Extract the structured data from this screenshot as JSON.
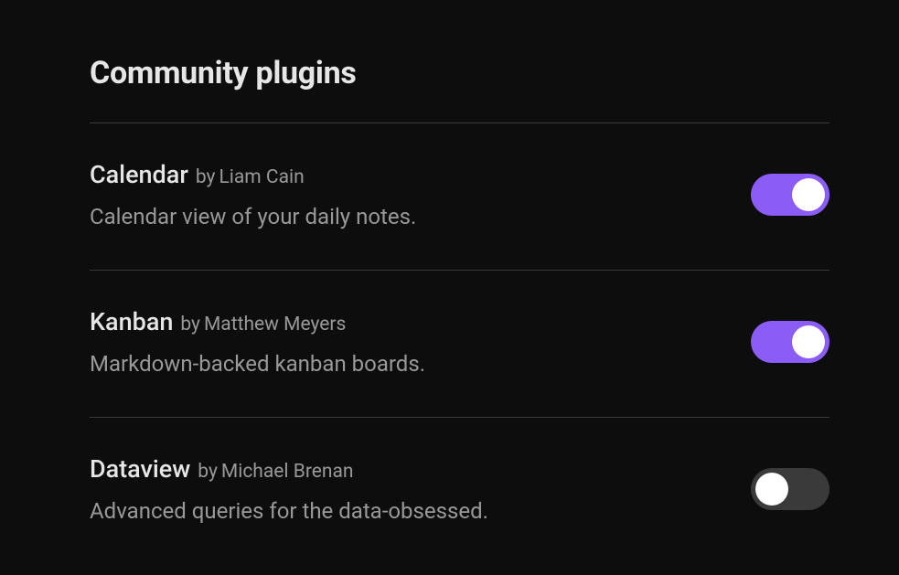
{
  "title": "Community plugins",
  "byLabel": "by",
  "plugins": [
    {
      "name": "Calendar",
      "author": "Liam Cain",
      "description": "Calendar view of your daily notes.",
      "enabled": true
    },
    {
      "name": "Kanban",
      "author": "Matthew Meyers",
      "description": "Markdown-backed kanban boards.",
      "enabled": true
    },
    {
      "name": "Dataview",
      "author": "Michael Brenan",
      "description": "Advanced queries for the data-obsessed.",
      "enabled": false
    }
  ]
}
